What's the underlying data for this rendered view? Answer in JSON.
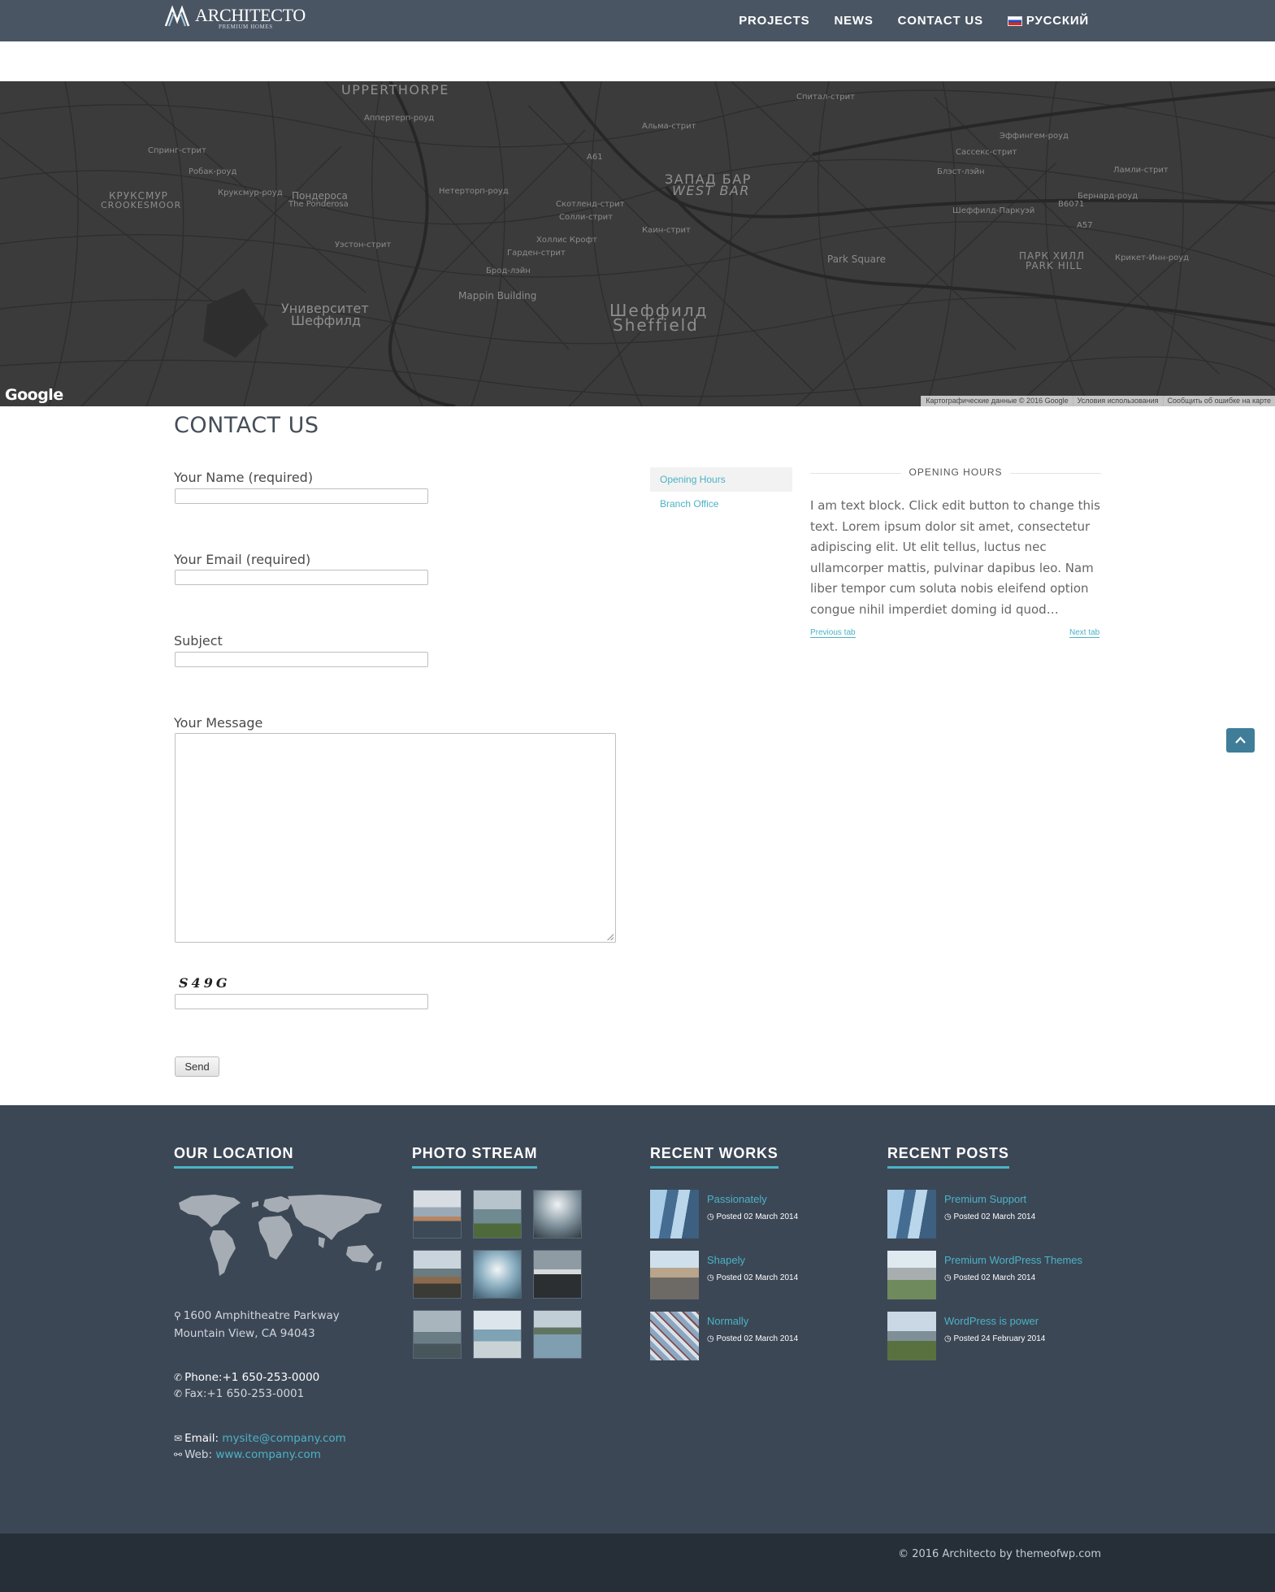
{
  "brand": {
    "name": "ARCHITECTO",
    "tagline": "PREMIUM HOMES"
  },
  "nav": {
    "items": [
      "PROJECTS",
      "NEWS",
      "CONTACT US"
    ],
    "language": "РУССКИЙ"
  },
  "map": {
    "labels": [
      "UPPERTHORPE",
      "КРУКСМУР",
      "CROOKESMOOR",
      "Пондероса",
      "The Ponderosa",
      "ЗАПАД БАР",
      "WEST BAR",
      "Park Square",
      "ПАРК ХИЛЛ",
      "PARK HILL",
      "Mappin Building",
      "Университет",
      "Шеффилд",
      "Шеффилд",
      "Sheffield",
      "A61",
      "A57",
      "B6071",
      "Альма-стрит",
      "Спитал-стрит",
      "Сассекс-стрит",
      "Шеффилд-Паркуэй",
      "Эффингем-роуд",
      "Ламли-стрит",
      "Бернард-роуд",
      "Крикет-Инн-роуд",
      "Скотленд-стрит",
      "Солли-стрит",
      "Каин-стрит",
      "Холлис Крофт",
      "Гарден-стрит",
      "Брод-лэйн",
      "Уэстон-стрит",
      "Робак-роуд",
      "Круксмур-роуд",
      "Нетерторп-роуд",
      "Аппертерп-роуд",
      "Блэст-лэйн",
      "Спринг-стрит"
    ],
    "google": "Google",
    "attribution": [
      "Картографические данные © 2016 Google",
      "Условия использования",
      "Сообщить об ошибке на карте"
    ]
  },
  "contact": {
    "title": "CONTACT US",
    "name_label": "Your Name (required)",
    "email_label": "Your Email (required)",
    "subject_label": "Subject",
    "message_label": "Your Message",
    "captcha": "S49G",
    "send": "Send"
  },
  "tabs": {
    "items": [
      "Opening Hours",
      "Branch Office"
    ],
    "heading": "OPENING HOURS",
    "text": "I am text block. Click edit button to change this text. Lorem ipsum dolor sit amet, consectetur adipiscing elit. Ut elit tellus, luctus nec ullamcorper mattis, pulvinar dapibus leo. Nam liber tempor cum soluta nobis eleifend option congue nihil imperdiet doming id quod…",
    "prev": "Previous tab",
    "next": "Next tab"
  },
  "footer": {
    "location": {
      "title": "OUR LOCATION",
      "address": "1600 Amphitheatre Parkway Mountain View, CA 94043",
      "phone_label": "Phone:",
      "phone": "+1 650-253-0000",
      "fax_label": "Fax:",
      "fax": "+1 650-253-0001",
      "email_label": "Email:",
      "email": "mysite@company.com",
      "web_label": "Web:",
      "web": "www.company.com"
    },
    "photo_stream": {
      "title": "PHOTO STREAM"
    },
    "recent_works": {
      "title": "RECENT WORKS",
      "items": [
        {
          "title": "Passionately",
          "date": "Posted 02 March 2014"
        },
        {
          "title": "Shapely",
          "date": "Posted 02 March 2014"
        },
        {
          "title": "Normally",
          "date": "Posted 02 March 2014"
        }
      ]
    },
    "recent_posts": {
      "title": "RECENT POSTS",
      "items": [
        {
          "title": "Premium Support",
          "date": "Posted 02 March 2014"
        },
        {
          "title": "Premium WordPress Themes",
          "date": "Posted 02 March 2014"
        },
        {
          "title": "WordPress is power",
          "date": "Posted 24 February 2014"
        }
      ]
    },
    "copyright": "© 2016 Architecto by themeofwp.com"
  },
  "colors": {
    "header": "#4a5563",
    "accent": "#4ab3c5",
    "footer": "#3c4756",
    "footer_bottom": "#262e38",
    "to_top": "#3f7d99"
  }
}
